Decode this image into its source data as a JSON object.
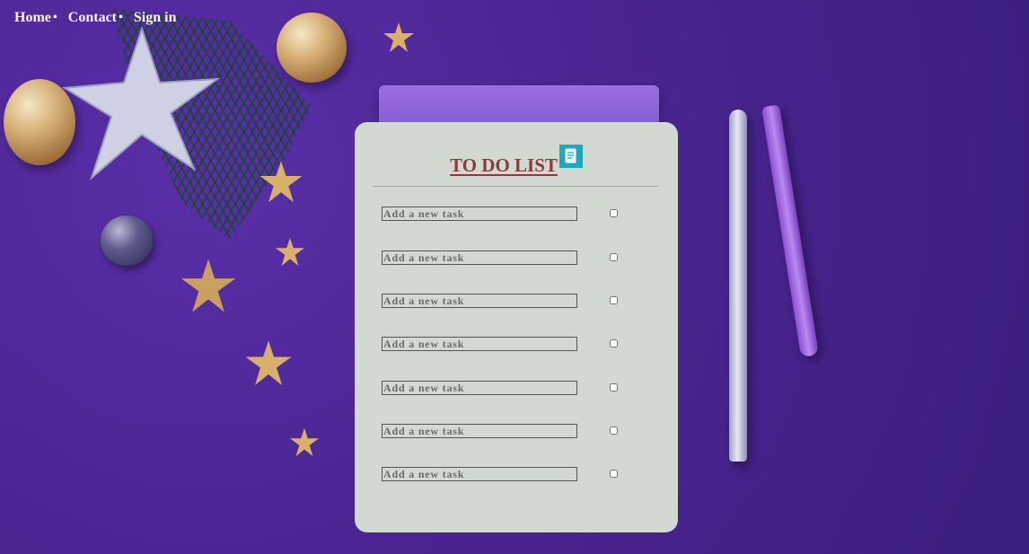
{
  "nav": {
    "items": [
      {
        "label": "Home",
        "sep": "•"
      },
      {
        "label": "Contact",
        "sep": "•"
      },
      {
        "label": "Sign in"
      }
    ]
  },
  "card": {
    "title": "TO DO LIST",
    "title_icon": "notepad-icon",
    "tasks": [
      {
        "placeholder": "Add a new task",
        "checked": false
      },
      {
        "placeholder": "Add a new task",
        "checked": false
      },
      {
        "placeholder": "Add a new task",
        "checked": false
      },
      {
        "placeholder": "Add a new task",
        "checked": false
      },
      {
        "placeholder": "Add a new task",
        "checked": false
      },
      {
        "placeholder": "Add a new task",
        "checked": false
      },
      {
        "placeholder": "Add a new task",
        "checked": false
      }
    ]
  },
  "colors": {
    "title": "#8a3b3b",
    "card_bg": "#d1d9d0",
    "icon_bg": "#21a7bd",
    "background": "#4a2591"
  }
}
